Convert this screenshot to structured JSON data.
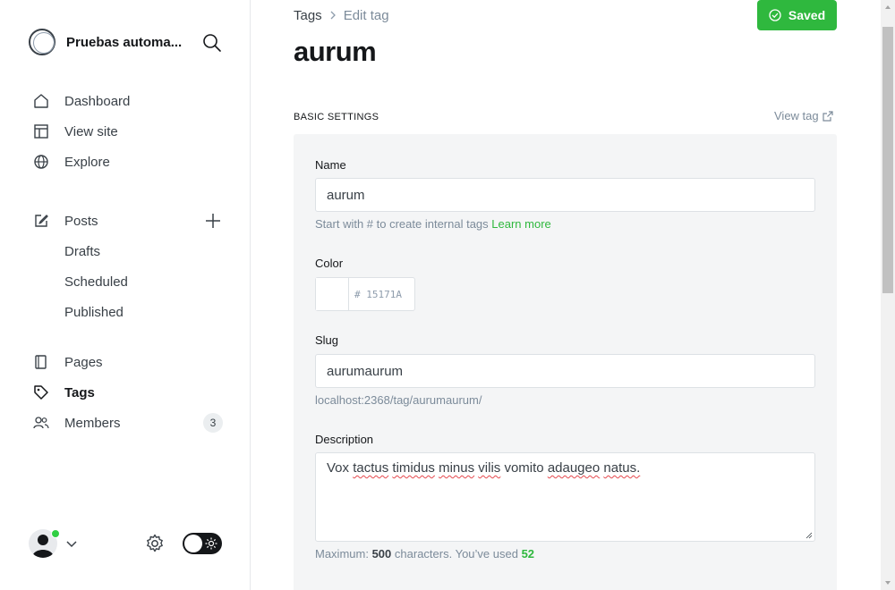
{
  "sidebar": {
    "site_title": "Pruebas automa...",
    "nav_primary": [
      {
        "label": "Dashboard",
        "icon": "home-icon"
      },
      {
        "label": "View site",
        "icon": "layout-icon"
      },
      {
        "label": "Explore",
        "icon": "globe-icon"
      }
    ],
    "posts": {
      "label": "Posts",
      "subitems": [
        "Drafts",
        "Scheduled",
        "Published"
      ]
    },
    "nav_secondary": [
      {
        "label": "Pages",
        "icon": "page-icon"
      },
      {
        "label": "Tags",
        "icon": "tag-icon",
        "active": true
      },
      {
        "label": "Members",
        "icon": "members-icon",
        "badge": "3"
      }
    ]
  },
  "header": {
    "breadcrumb_parent": "Tags",
    "breadcrumb_current": "Edit tag",
    "saved_label": "Saved",
    "title": "aurum"
  },
  "settings": {
    "section_title": "BASIC SETTINGS",
    "view_tag_label": "View tag",
    "name_label": "Name",
    "name_value": "aurum",
    "name_help": "Start with # to create internal tags",
    "name_help_link": "Learn more",
    "color_label": "Color",
    "color_hash": "#",
    "color_placeholder": "15171A",
    "slug_label": "Slug",
    "slug_value": "aurumaurum",
    "slug_url": "localhost:2368/tag/aurumaurum/",
    "description_label": "Description",
    "description_words": [
      "Vox",
      "tactus",
      "timidus",
      "minus",
      "vilis",
      "vomito",
      "adaugeo",
      "natus."
    ],
    "description_help_prefix": "Maximum:",
    "description_max": "500",
    "description_help_mid": "characters. You’ve used",
    "description_used": "52"
  },
  "colors": {
    "accent": "#30cf43",
    "text": "#15171a",
    "muted": "#7c8b9a",
    "panel": "#f4f5f6"
  }
}
